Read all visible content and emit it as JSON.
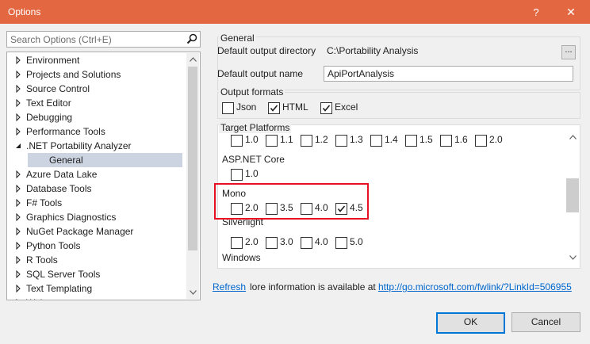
{
  "window": {
    "title": "Options",
    "help_glyph": "?",
    "close_glyph": "✕",
    "accent": "#e36842"
  },
  "search": {
    "placeholder": "Search Options (Ctrl+E)"
  },
  "tree": {
    "items": [
      {
        "label": "Environment",
        "expanded": false
      },
      {
        "label": "Projects and Solutions",
        "expanded": false
      },
      {
        "label": "Source Control",
        "expanded": false
      },
      {
        "label": "Text Editor",
        "expanded": false
      },
      {
        "label": "Debugging",
        "expanded": false
      },
      {
        "label": "Performance Tools",
        "expanded": false
      },
      {
        "label": ".NET Portability Analyzer",
        "expanded": true
      },
      {
        "label": "General",
        "selected": true
      },
      {
        "label": "Azure Data Lake",
        "expanded": false
      },
      {
        "label": "Database Tools",
        "expanded": false
      },
      {
        "label": "F# Tools",
        "expanded": false
      },
      {
        "label": "Graphics Diagnostics",
        "expanded": false
      },
      {
        "label": "NuGet Package Manager",
        "expanded": false
      },
      {
        "label": "Python Tools",
        "expanded": false
      },
      {
        "label": "R Tools",
        "expanded": false
      },
      {
        "label": "SQL Server Tools",
        "expanded": false
      },
      {
        "label": "Text Templating",
        "expanded": false
      },
      {
        "label": "Web",
        "expanded": false
      }
    ]
  },
  "general": {
    "heading": "General",
    "output_dir_label": "Default output directory",
    "output_dir_value": "C:\\Portability Analysis",
    "browse_label": "...",
    "output_name_label": "Default output name",
    "output_name_value": "ApiPortAnalysis"
  },
  "formats": {
    "heading": "Output formats",
    "options": [
      {
        "label": "Json",
        "checked": false
      },
      {
        "label": "HTML",
        "checked": true
      },
      {
        "label": "Excel",
        "checked": true
      }
    ]
  },
  "platforms": {
    "heading": "Target Platforms",
    "top_row": [
      {
        "label": "1.0",
        "checked": false
      },
      {
        "label": "1.1",
        "checked": false
      },
      {
        "label": "1.2",
        "checked": false
      },
      {
        "label": "1.3",
        "checked": false
      },
      {
        "label": "1.4",
        "checked": false
      },
      {
        "label": "1.5",
        "checked": false
      },
      {
        "label": "1.6",
        "checked": false
      },
      {
        "label": "2.0",
        "checked": false
      }
    ],
    "aspnet": {
      "title": "ASP.NET Core",
      "versions": [
        {
          "label": "1.0",
          "checked": false
        }
      ]
    },
    "mono": {
      "title": "Mono",
      "versions": [
        {
          "label": "2.0",
          "checked": false
        },
        {
          "label": "3.5",
          "checked": false
        },
        {
          "label": "4.0",
          "checked": false
        },
        {
          "label": "4.5",
          "checked": true
        }
      ]
    },
    "silverlight": {
      "title": "Silverlight",
      "versions": [
        {
          "label": "2.0",
          "checked": false
        },
        {
          "label": "3.0",
          "checked": false
        },
        {
          "label": "4.0",
          "checked": false
        },
        {
          "label": "5.0",
          "checked": false
        }
      ]
    },
    "windows": {
      "title": "Windows"
    }
  },
  "footer": {
    "refresh_link": "Refresh",
    "info_text": "lore information is available at",
    "info_link": "http://go.microsoft.com/fwlink/?LinkId=506955"
  },
  "buttons": {
    "ok": "OK",
    "cancel": "Cancel"
  },
  "highlight_color": "#e81123"
}
